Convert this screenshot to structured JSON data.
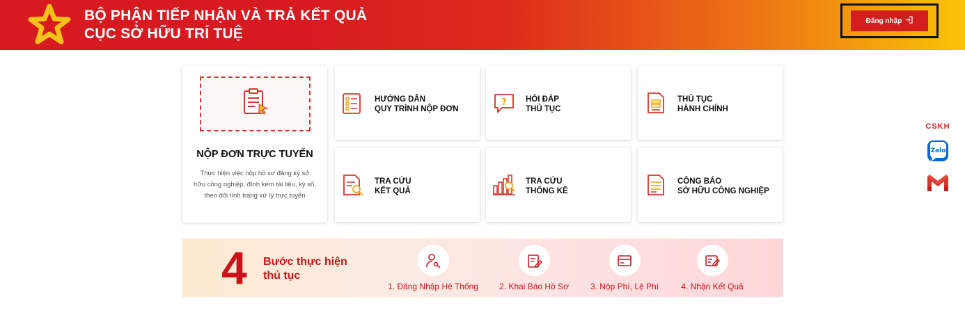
{
  "header": {
    "title_line1": "BỘ PHẬN TIẾP NHẬN VÀ TRẢ KẾT QUẢ",
    "title_line2": "CỤC SỞ HỮU TRÍ TUỆ",
    "login_label": "Đăng nhập",
    "colors": {
      "start": "#d71920",
      "end": "#f9c406"
    }
  },
  "main_card": {
    "title": "NỘP ĐƠN TRỰC TUYẾN",
    "description": "Thực hiện việc nộp hồ sơ đăng ký sở hữu công nghiệp, đính kèm tài liệu, ký số, theo dõi tình trạng xử lý trực tuyến",
    "icon": "clipboard-cursor-icon"
  },
  "cards": [
    {
      "line1": "HƯỚNG DẪN",
      "line2": "QUY TRÌNH NỘP ĐƠN",
      "icon": "checklist-icon"
    },
    {
      "line1": "HỎI ĐÁP",
      "line2": "THỦ TỤC",
      "icon": "chat-question-icon"
    },
    {
      "line1": "THỦ TỤC",
      "line2": "HÀNH CHÍNH",
      "icon": "document-stack-icon"
    },
    {
      "line1": "TRA CỨU",
      "line2": "KẾT QUẢ",
      "icon": "document-search-icon"
    },
    {
      "line1": "TRA CỨU",
      "line2": "THỐNG KÊ",
      "icon": "chart-search-icon"
    },
    {
      "line1": "CÔNG BÁO",
      "line2": "SỞ HỮU CÔNG NGHIỆP",
      "icon": "document-list-icon"
    }
  ],
  "steps": {
    "number": "4",
    "title_line1": "Bước thực hiện",
    "title_line2": "thủ tục",
    "items": [
      {
        "label": "1. Đăng Nhập Hệ Thống",
        "icon": "user-key-icon"
      },
      {
        "label": "2. Khai Báo Hồ Sơ",
        "icon": "form-edit-icon"
      },
      {
        "label": "3. Nộp Phí, Lệ Phí",
        "icon": "card-payment-icon"
      },
      {
        "label": "4. Nhận Kết Quả",
        "icon": "result-edit-icon"
      }
    ]
  },
  "support": {
    "label": "CSKH",
    "zalo_text": "Zalo",
    "gmail_icon": "gmail-icon"
  },
  "accent_color": "#d41e1e"
}
